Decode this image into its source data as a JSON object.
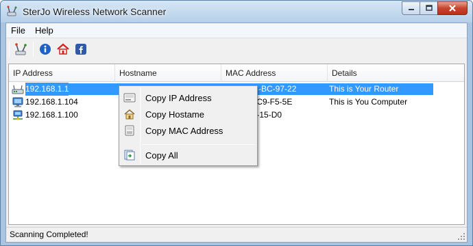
{
  "window": {
    "title": "SterJo Wireless Network Scanner"
  },
  "menu": {
    "file": "File",
    "help": "Help"
  },
  "toolbar": {
    "icons": [
      "scan-icon",
      "info-icon",
      "home-icon",
      "facebook-icon"
    ]
  },
  "list": {
    "columns": {
      "ip": "IP Address",
      "hostname": "Hostname",
      "mac": "MAC Address",
      "details": "Details"
    },
    "rows": [
      {
        "ip": "192.168.1.1",
        "hostname": "",
        "mac": "54-E6-FC-BC-97-22",
        "details": "This is Your Router",
        "icon": "router-icon",
        "selected": true
      },
      {
        "ip": "192.168.1.104",
        "hostname": "",
        "mac": "00-1D-D-C9-F5-5E",
        "details": "This is You Computer",
        "icon": "computer-icon",
        "selected": false
      },
      {
        "ip": "192.168.1.100",
        "hostname": "",
        "mac": "88-E4-77-15-D0",
        "details": "",
        "icon": "network-device-icon",
        "selected": false
      }
    ]
  },
  "context_menu": {
    "copy_ip": "Copy IP Address",
    "copy_host": "Copy Hostame",
    "copy_mac": "Copy MAC Address",
    "copy_all": "Copy All"
  },
  "status": {
    "text": "Scanning Completed!"
  },
  "colors": {
    "selection": "#3399ff",
    "titlebar": "#b6cfe8",
    "close": "#c7452c"
  }
}
